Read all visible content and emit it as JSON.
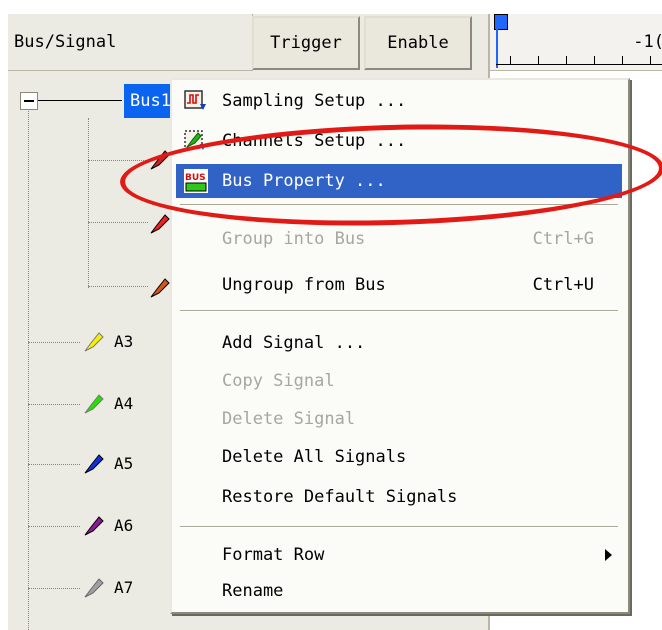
{
  "header": {
    "bus_signal_label": "Bus/Signal",
    "trigger_label": "Trigger",
    "enable_label": "Enable",
    "ruler_label": "-1("
  },
  "tree": {
    "bus_name": "Bus1",
    "signals": [
      {
        "name": "A3",
        "color": "#f5f000"
      },
      {
        "name": "A4",
        "color": "#22e000"
      },
      {
        "name": "A5",
        "color": "#1030e0"
      },
      {
        "name": "A6",
        "color": "#8a1a9a"
      },
      {
        "name": "A7",
        "color": "#a0a0a0"
      }
    ],
    "bus_child_colors": [
      "#cc2222",
      "#ee2222",
      "#d4561a"
    ]
  },
  "context_menu": {
    "items": [
      {
        "label": "Sampling Setup ...",
        "shortcut": "",
        "enabled": true,
        "icon": "sampling-setup-icon"
      },
      {
        "label": "Channels Setup ...",
        "shortcut": "",
        "enabled": true,
        "icon": "channels-setup-icon"
      },
      {
        "label": "Bus Property ...",
        "shortcut": "",
        "enabled": true,
        "icon": "bus-property-icon",
        "selected": true
      },
      {
        "label": "Group into Bus",
        "shortcut": "Ctrl+G",
        "enabled": false
      },
      {
        "label": "Ungroup from Bus",
        "shortcut": "Ctrl+U",
        "enabled": true
      },
      {
        "label": "Add Signal ...",
        "shortcut": "",
        "enabled": true
      },
      {
        "label": "Copy Signal",
        "shortcut": "",
        "enabled": false
      },
      {
        "label": "Delete Signal",
        "shortcut": "",
        "enabled": false
      },
      {
        "label": "Delete All Signals",
        "shortcut": "",
        "enabled": true
      },
      {
        "label": "Restore Default Signals",
        "shortcut": "",
        "enabled": true
      },
      {
        "label": "Format Row",
        "shortcut": "",
        "enabled": true,
        "submenu": true
      },
      {
        "label": "Rename",
        "shortcut": "",
        "enabled": true
      }
    ],
    "bus_icon_text": "BUS"
  },
  "colors": {
    "selection": "#3163c6",
    "annotation": "#e11a16"
  }
}
